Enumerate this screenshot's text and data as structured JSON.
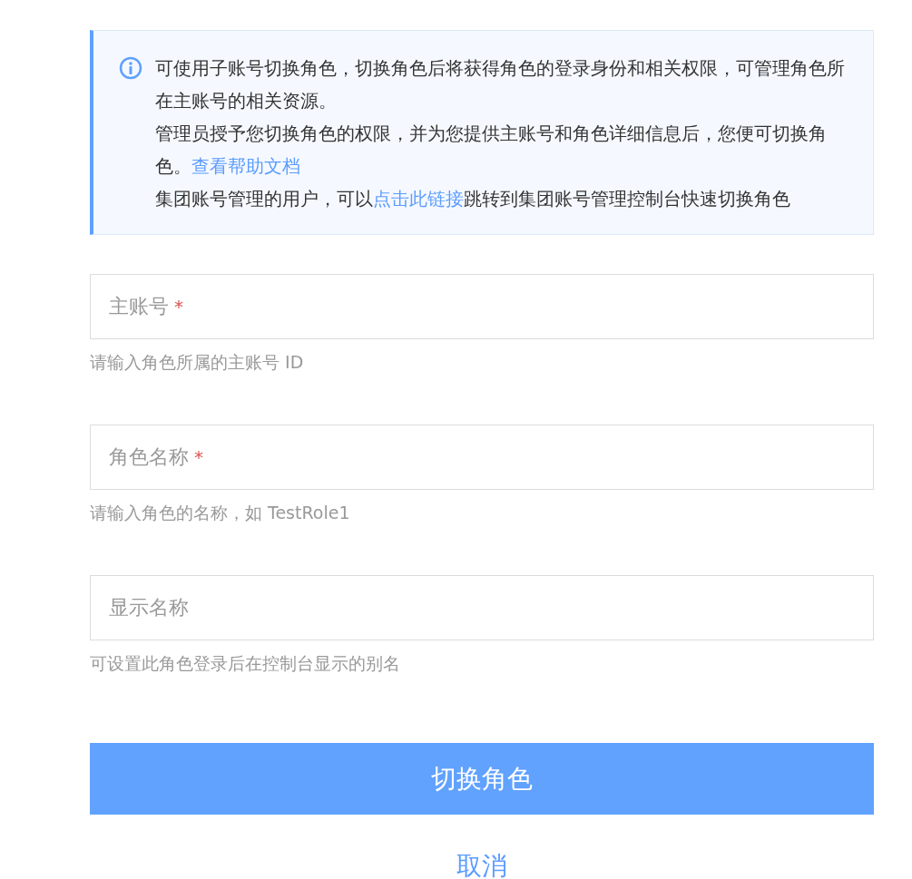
{
  "notice": {
    "paragraphs": [
      {
        "parts": [
          {
            "kind": "text",
            "text": "可使用子账号切换角色，切换角色后将获得角色的登录身份和相关权限，可管理角色所在主账号的相关资源。"
          }
        ]
      },
      {
        "parts": [
          {
            "kind": "text",
            "text": "管理员授予您切换角色的权限，并为您提供主账号和角色详细信息后，您便可切换角色。"
          },
          {
            "kind": "link",
            "text": "查看帮助文档"
          }
        ]
      },
      {
        "parts": [
          {
            "kind": "text",
            "text": "集团账号管理的用户，可以"
          },
          {
            "kind": "link",
            "text": "点击此链接"
          },
          {
            "kind": "text",
            "text": "跳转到集团账号管理控制台快速切换角色"
          }
        ]
      }
    ]
  },
  "fields": [
    {
      "label": "主账号",
      "required_mark": "*",
      "hint": "请输入角色所属的主账号 ID"
    },
    {
      "label": "角色名称",
      "required_mark": "*",
      "hint": "请输入角色的名称，如 TestRole1"
    },
    {
      "label": "显示名称",
      "hint": "可设置此角色登录后在控制台显示的别名"
    }
  ],
  "submit_button": "切换角色",
  "cancel_link": "取消"
}
